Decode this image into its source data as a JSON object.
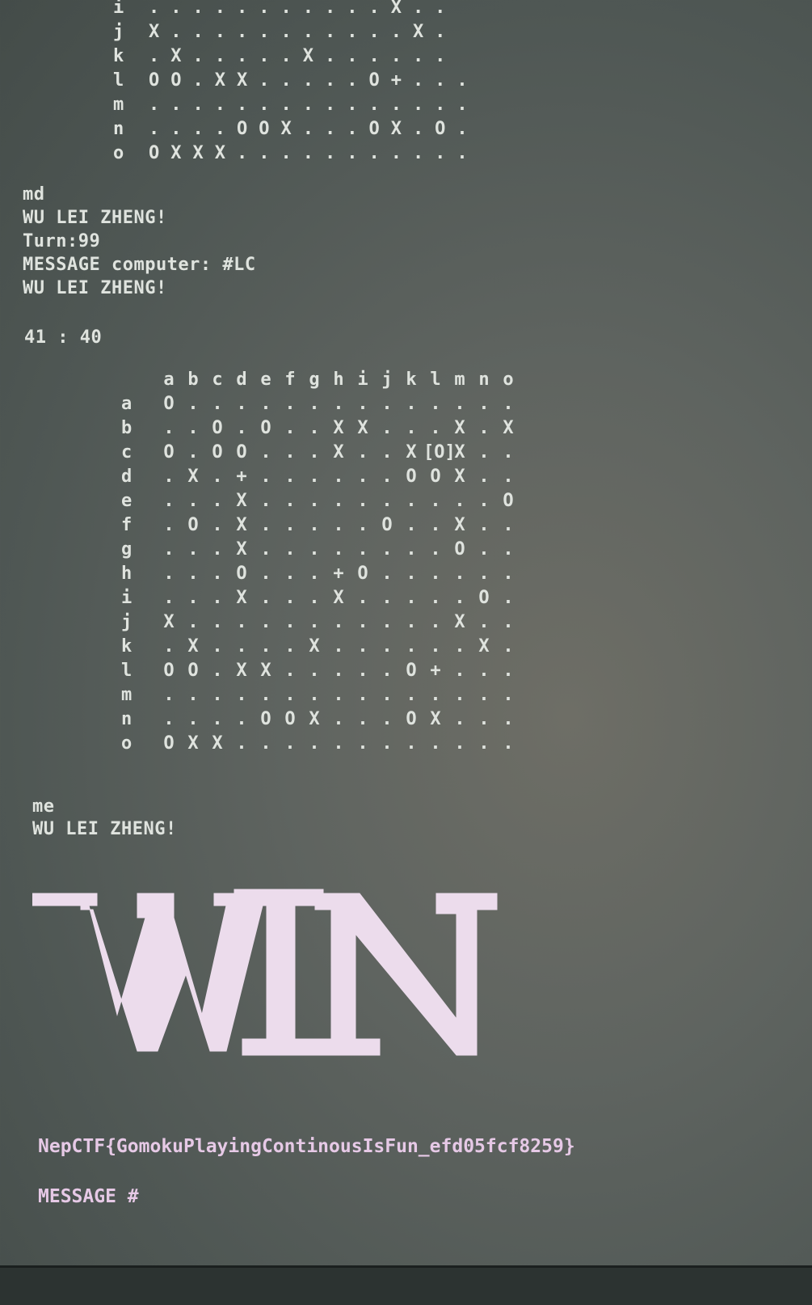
{
  "top_board": {
    "rows": [
      {
        "label": "i",
        "cells": "...........X.."
      },
      {
        "label": "j",
        "cells": "X...........X."
      },
      {
        "label": "k",
        "cells": ".X.....X......"
      },
      {
        "label": "l",
        "cells": "OO.XX.....O+..."
      },
      {
        "label": "m",
        "cells": "..............."
      },
      {
        "label": "n",
        "cells": "....OOX...OX.O."
      },
      {
        "label": "o",
        "cells": "OXXX..........."
      }
    ]
  },
  "log": {
    "line1": "md",
    "line2": "WU LEI ZHENG!",
    "line3": "Turn:99",
    "line4": "MESSAGE computer: #LC",
    "line5": "WU LEI ZHENG!",
    "score": "41 : 40"
  },
  "board": {
    "columns": [
      "a",
      "b",
      "c",
      "d",
      "e",
      "f",
      "g",
      "h",
      "i",
      "j",
      "k",
      "l",
      "m",
      "n",
      "o"
    ],
    "rows": [
      {
        "label": "a",
        "cells": [
          "O",
          ".",
          ".",
          ".",
          ".",
          ".",
          ".",
          ".",
          ".",
          ".",
          ".",
          ".",
          ".",
          ".",
          "."
        ]
      },
      {
        "label": "b",
        "cells": [
          ".",
          ".",
          "O",
          ".",
          "O",
          ".",
          ".",
          "X",
          "X",
          ".",
          ".",
          ".",
          "X",
          ".",
          "X"
        ]
      },
      {
        "label": "c",
        "cells": [
          "O",
          ".",
          "O",
          "O",
          ".",
          ".",
          ".",
          "X",
          ".",
          ".",
          "X",
          "[O]",
          "X",
          ".",
          "."
        ]
      },
      {
        "label": "d",
        "cells": [
          ".",
          "X",
          ".",
          "+",
          ".",
          ".",
          ".",
          ".",
          ".",
          ".",
          "O",
          "O",
          "X",
          ".",
          "."
        ]
      },
      {
        "label": "e",
        "cells": [
          ".",
          ".",
          ".",
          "X",
          ".",
          ".",
          ".",
          ".",
          ".",
          ".",
          ".",
          ".",
          ".",
          ".",
          "O"
        ]
      },
      {
        "label": "f",
        "cells": [
          ".",
          "O",
          ".",
          "X",
          ".",
          ".",
          ".",
          ".",
          ".",
          "O",
          ".",
          ".",
          "X",
          ".",
          "."
        ]
      },
      {
        "label": "g",
        "cells": [
          ".",
          ".",
          ".",
          "X",
          ".",
          ".",
          ".",
          ".",
          ".",
          ".",
          ".",
          ".",
          "O",
          ".",
          "."
        ]
      },
      {
        "label": "h",
        "cells": [
          ".",
          ".",
          ".",
          "O",
          ".",
          ".",
          ".",
          "+",
          "O",
          ".",
          ".",
          ".",
          ".",
          ".",
          "."
        ]
      },
      {
        "label": "i",
        "cells": [
          ".",
          ".",
          ".",
          "X",
          ".",
          ".",
          ".",
          "X",
          ".",
          ".",
          ".",
          ".",
          ".",
          "O",
          "."
        ]
      },
      {
        "label": "j",
        "cells": [
          "X",
          ".",
          ".",
          ".",
          ".",
          ".",
          ".",
          ".",
          ".",
          ".",
          ".",
          ".",
          "X",
          ".",
          "."
        ]
      },
      {
        "label": "k",
        "cells": [
          ".",
          "X",
          ".",
          ".",
          ".",
          ".",
          "X",
          ".",
          ".",
          ".",
          ".",
          ".",
          ".",
          "X",
          "."
        ]
      },
      {
        "label": "l",
        "cells": [
          "O",
          "O",
          ".",
          "X",
          "X",
          ".",
          ".",
          ".",
          ".",
          ".",
          "O",
          "+",
          ".",
          ".",
          "."
        ]
      },
      {
        "label": "m",
        "cells": [
          ".",
          ".",
          ".",
          ".",
          ".",
          ".",
          ".",
          ".",
          ".",
          ".",
          ".",
          ".",
          ".",
          ".",
          "."
        ]
      },
      {
        "label": "n",
        "cells": [
          ".",
          ".",
          ".",
          ".",
          "O",
          "O",
          "X",
          ".",
          ".",
          ".",
          "O",
          "X",
          ".",
          ".",
          "."
        ]
      },
      {
        "label": "o",
        "cells": [
          "O",
          "X",
          "X",
          ".",
          ".",
          ".",
          ".",
          ".",
          ".",
          ".",
          ".",
          ".",
          ".",
          ".",
          "."
        ]
      }
    ]
  },
  "after": {
    "line1": "me",
    "line2": "WU LEI ZHENG!"
  },
  "banner": {
    "text": "WIN",
    "color": "#ecdcec"
  },
  "flag": "NepCTF{GomokuPlayingContinousIsFun_efd05fcf8259}",
  "prompt": "MESSAGE #"
}
